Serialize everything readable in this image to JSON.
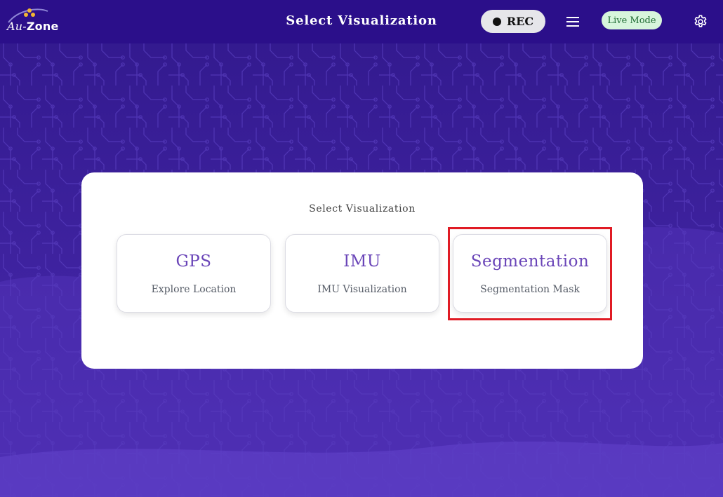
{
  "header": {
    "logo_prefix": "Au-",
    "logo_name": "Zone",
    "title": "Select Visualization",
    "rec_label": "REC",
    "mode_label": "Live Mode"
  },
  "panel": {
    "title": "Select Visualization",
    "options": [
      {
        "name": "GPS",
        "description": "Explore Location"
      },
      {
        "name": "IMU",
        "description": "IMU Visualization"
      },
      {
        "name": "Segmentation",
        "description": "Segmentation Mask"
      }
    ]
  },
  "colors": {
    "topbar": "#2b0f8a",
    "background": "#3a1f9c",
    "accent_text": "#6a45b8",
    "live_mode_bg": "#d7f5dc",
    "highlight": "#e01b24"
  },
  "icons": [
    "au-zone-logo-icon",
    "record-dot-icon",
    "hamburger-menu-icon",
    "gear-icon"
  ],
  "highlighted_option": "Segmentation"
}
